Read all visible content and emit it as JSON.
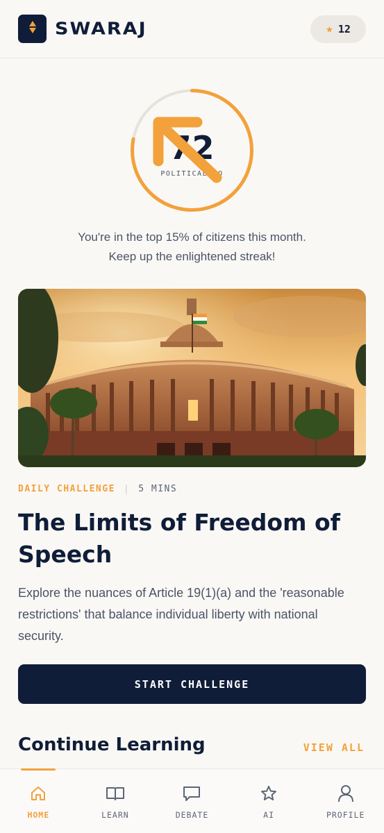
{
  "header": {
    "brand": "SWARAJ",
    "points": "12",
    "icons": {
      "logo": "compass-diamond-icon",
      "points": "star-icon"
    }
  },
  "score": {
    "value": "72",
    "label": "POLITICAL IQ",
    "progress": 0.78,
    "colors": {
      "progress": "#f2a13b",
      "track": "#e6e2dc"
    }
  },
  "rank": {
    "line1": "You're in the top 15% of citizens this month.",
    "line2": "Keep up the enlightened streak!"
  },
  "challenge": {
    "category": "DAILY CHALLENGE",
    "separator": "|",
    "duration": "5 MINS",
    "title": "The Limits of Freedom of Speech",
    "description": "Explore the nuances of Article 19(1)(a) and the 'reasonable restrictions' that balance individual liberty with national security.",
    "cta": "START CHALLENGE"
  },
  "continue": {
    "title": "Continue Learning",
    "view_all": "VIEW ALL"
  },
  "nav": {
    "items": [
      {
        "label": "HOME",
        "icon": "home-icon",
        "active": true
      },
      {
        "label": "LEARN",
        "icon": "book-icon",
        "active": false
      },
      {
        "label": "DEBATE",
        "icon": "chat-bubble-icon",
        "active": false
      },
      {
        "label": "AI",
        "icon": "star-outline-icon",
        "active": false
      },
      {
        "label": "PROFILE",
        "icon": "user-icon",
        "active": false
      }
    ]
  },
  "colors": {
    "accent": "#f2a13b",
    "navy": "#0f1d38",
    "background": "#faf8f5"
  }
}
